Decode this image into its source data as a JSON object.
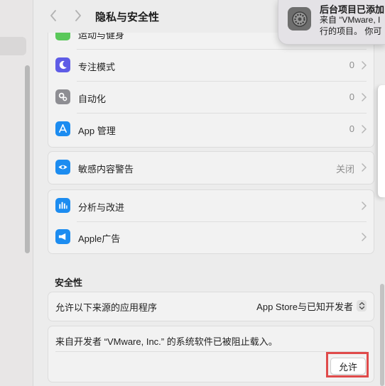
{
  "toolbar": {
    "title": "隐私与安全性",
    "back_icon": "chevron-left-icon",
    "forward_icon": "chevron-right-icon"
  },
  "partial_row": {
    "label": "运动与健身",
    "icon": "fitness-icon",
    "color": "#5ac85a"
  },
  "group1": [
    {
      "label": "专注模式",
      "value": "0",
      "icon": "moon-icon",
      "color": "#5e5ce6"
    },
    {
      "label": "自动化",
      "value": "0",
      "icon": "gears-icon",
      "color": "#8e8e93"
    },
    {
      "label": "App 管理",
      "value": "0",
      "icon": "app-store-icon",
      "color": "#1c8cf0"
    }
  ],
  "group2": [
    {
      "label": "敏感内容警告",
      "value": "关闭",
      "icon": "eye-warning-icon",
      "color": "#1c8cf0"
    }
  ],
  "group3": [
    {
      "label": "分析与改进",
      "value": "",
      "icon": "bar-chart-icon",
      "color": "#1c8cf0"
    },
    {
      "label": "Apple广告",
      "value": "",
      "icon": "megaphone-icon",
      "color": "#1c8cf0"
    }
  ],
  "security": {
    "title": "安全性",
    "source_label": "允许以下来源的应用程序",
    "source_value": "App Store与已知开发者",
    "blocked_text": "来自开发者 “VMware, Inc.” 的系统软件已被阻止载入。",
    "allow_label": "允许",
    "highlight_color": "#e04b4b"
  },
  "notification": {
    "title": "后台项目已添加",
    "line1": "来自 “VMware, I",
    "line2": "行的项目。 你可",
    "icon": "settings-gear-icon"
  }
}
